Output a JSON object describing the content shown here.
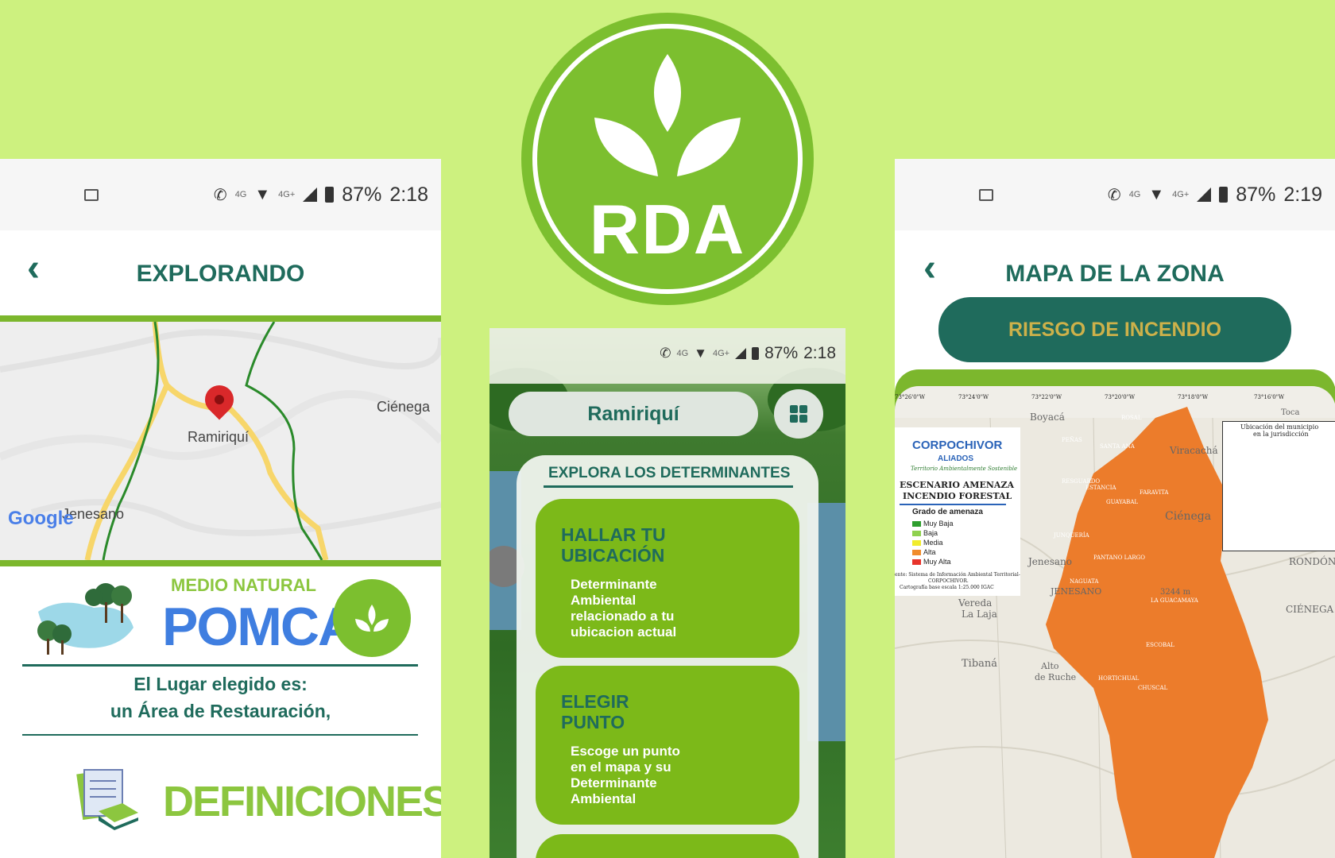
{
  "left_phone": {
    "status": {
      "battery": "87%",
      "time": "2:18",
      "net1": "4G",
      "net2": "4G+"
    },
    "title": "EXPLORANDO",
    "map": {
      "labels": {
        "town": "Ramiriquí",
        "nearby": "Ciénega",
        "other": "Jenesano"
      },
      "logo": "Google"
    },
    "medio_natural": "MEDIO NATURAL",
    "pomca": "POMCA",
    "result_line1": "El Lugar elegido es:",
    "result_line2": "un Área de Restauración,",
    "definiciones": "DEFINICIONES"
  },
  "brand": {
    "logo_text": "RDA"
  },
  "center_phone": {
    "status": {
      "battery": "87%",
      "time": "2:18",
      "net1": "4G",
      "net2": "4G+"
    },
    "location": "Ramiriquí",
    "section_title": "EXPLORA LOS DETERMINANTES",
    "cards": [
      {
        "title1": "HALLAR TU",
        "title2": "UBICACIÓN",
        "desc": [
          "Determinante",
          "Ambiental",
          "relacionado a tu",
          "ubicacion actual"
        ]
      },
      {
        "title1": "ELEGIR",
        "title2": "PUNTO",
        "desc": [
          "Escoge un punto",
          "en el mapa y su",
          "Determinante",
          "Ambiental"
        ]
      }
    ]
  },
  "right_phone": {
    "status": {
      "battery": "87%",
      "time": "2:19",
      "net1": "4G",
      "net2": "4G+"
    },
    "title": "MAPA DE LA ZONA",
    "risk_button": "RIESGO DE INCENDIO",
    "map": {
      "coords": [
        "73°26'0\"W",
        "73°24'0\"W",
        "73°22'0\"W",
        "73°20'0\"W",
        "73°18'0\"W",
        "73°16'0\"W"
      ],
      "org": "CORPOCHIVOR",
      "aliados": "ALIADOS",
      "slogan": "Territorio Ambientalmente Sostenible",
      "heading1": "ESCENARIO AMENAZA",
      "heading2": "INCENDIO FORESTAL",
      "legend_title": "Grado de amenaza",
      "legend": [
        {
          "label": "Muy Baja",
          "color": "#2e9e2e"
        },
        {
          "label": "Baja",
          "color": "#8fd14f"
        },
        {
          "label": "Media",
          "color": "#f1ec2c"
        },
        {
          "label": "Alta",
          "color": "#f08c2c"
        },
        {
          "label": "Muy Alta",
          "color": "#e8342c"
        }
      ],
      "source1": "ente: Sistema de Información Ambiental Territorial-",
      "source2": "CORPOCHIVOR.",
      "source3": "Cartografía base escala 1:25.000 IGAC",
      "inset_title1": "Ubicación del municipio",
      "inset_title2": "en la jurisdicción",
      "places": [
        "Boyacá",
        "Viracachá",
        "Ciénega",
        "Jenesano",
        "JENESANO",
        "Vereda",
        "La Laja",
        "Tibaná",
        "Alto",
        "de Ruche",
        "CIÉNEGA",
        "RONDÓN",
        "3244 m",
        "Toca"
      ],
      "veredas": [
        "ROSAL",
        "PEÑAS",
        "SANTA ANA",
        "RESGUARDO",
        "FARAVITA",
        "GUAYABAL",
        "CHUSCAL",
        "ESCOBAL",
        "PANTANO LARGO",
        "LA GUACAMAYA",
        "NAGUATA",
        "HORTICHUAL",
        "JUNQUERÍA",
        "ESTANCIA"
      ]
    }
  }
}
